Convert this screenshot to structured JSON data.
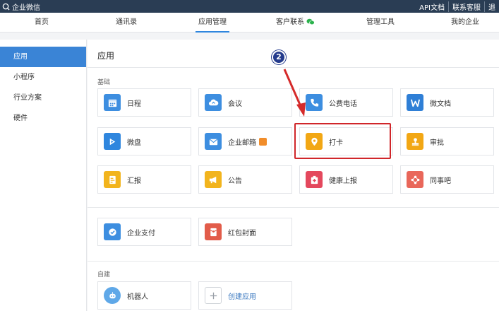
{
  "topbar": {
    "brand": "企业微信",
    "links": [
      "API文档",
      "联系客服",
      "退"
    ]
  },
  "nav": {
    "items": [
      "首页",
      "通讯录",
      "应用管理",
      "客户联系",
      "管理工具",
      "我的企业"
    ],
    "active": "应用管理"
  },
  "sidebar": {
    "items": [
      "应用",
      "小程序",
      "行业方案",
      "硬件"
    ],
    "active": "应用"
  },
  "main": {
    "title": "应用",
    "section_basic": "基础",
    "section_custom": "自建",
    "apps": [
      {
        "label": "日程",
        "icon": "calendar-icon",
        "color": "#3d8ee0"
      },
      {
        "label": "会议",
        "icon": "cloud-icon",
        "color": "#3d8ee0"
      },
      {
        "label": "公费电话",
        "icon": "phone-icon",
        "color": "#3d8ee0"
      },
      {
        "label": "微文档",
        "icon": "document-w-icon",
        "color": "#2f7fd6"
      },
      {
        "label": "微盘",
        "icon": "drive-icon",
        "color": "#2f86de"
      },
      {
        "label": "企业邮箱",
        "icon": "mail-icon",
        "color": "#3d8ee0"
      },
      {
        "label": "打卡",
        "icon": "location-pin-icon",
        "color": "#f2a714"
      },
      {
        "label": "审批",
        "icon": "stamp-icon",
        "color": "#f2a714"
      },
      {
        "label": "汇报",
        "icon": "report-icon",
        "color": "#f2b41d"
      },
      {
        "label": "公告",
        "icon": "megaphone-icon",
        "color": "#f2b41d"
      },
      {
        "label": "健康上报",
        "icon": "health-icon",
        "color": "#e4485d"
      },
      {
        "label": "同事吧",
        "icon": "diamond-icon",
        "color": "#e9675a"
      },
      {
        "label": "企业支付",
        "icon": "payment-icon",
        "color": "#3d8ee0"
      },
      {
        "label": "红包封面",
        "icon": "red-envelope-icon",
        "color": "#e25c4a"
      }
    ],
    "custom_apps": [
      {
        "label": "机器人",
        "icon": "robot-icon",
        "color": "#5fa8e8"
      },
      {
        "label": "创建应用",
        "icon": "plus-icon",
        "color": "#ffffff"
      }
    ]
  },
  "annotation": {
    "step": "2"
  },
  "colors": {
    "topbar": "#2a3d54",
    "accent": "#2f86de",
    "highlight": "#d0262a",
    "arrow": "#d52a2a"
  }
}
